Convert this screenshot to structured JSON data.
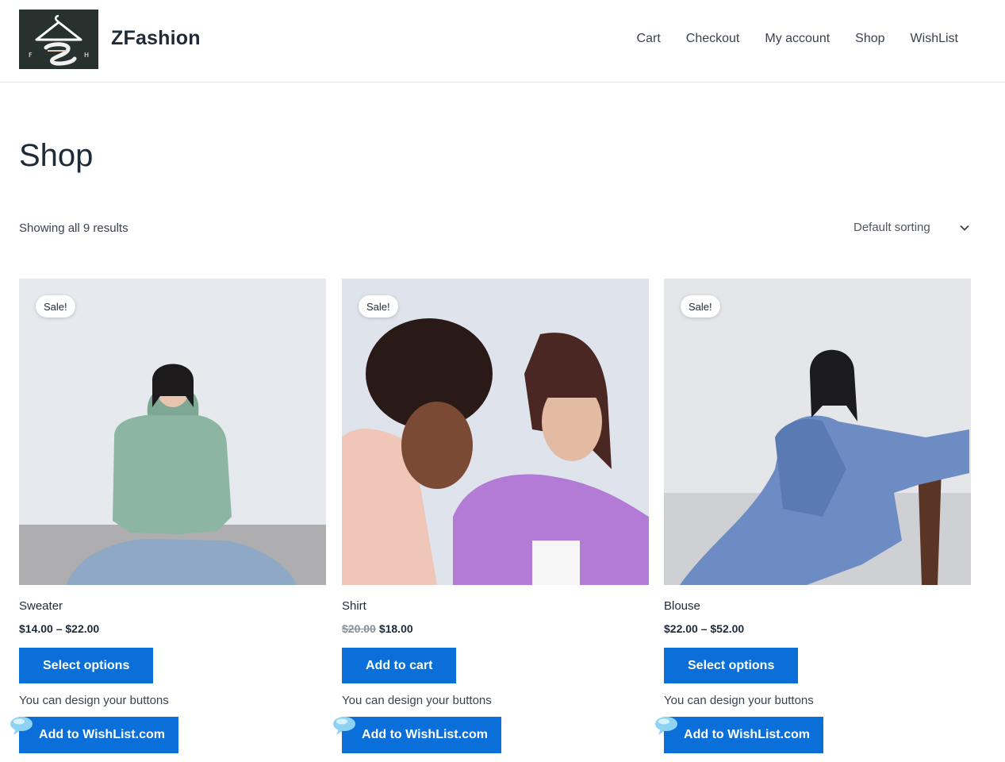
{
  "site": {
    "title": "ZFashion",
    "logo_icon": "hanger-logo-icon"
  },
  "nav": {
    "items": [
      "Cart",
      "Checkout",
      "My account",
      "Shop",
      "WishList"
    ]
  },
  "page": {
    "title": "Shop",
    "result_count": "Showing all 9 results",
    "ordering": "Default sorting"
  },
  "products": [
    {
      "name": "Sweater",
      "price": "$14.00 – $22.00",
      "old_price": "",
      "badge": "Sale!",
      "button": "Select options",
      "note": "You can design your buttons",
      "wishlist": "Add to WishList.com"
    },
    {
      "name": "Shirt",
      "price": "$18.00",
      "old_price": "$20.00",
      "badge": "Sale!",
      "button": "Add to cart",
      "note": "You can design your buttons",
      "wishlist": "Add to WishList.com"
    },
    {
      "name": "Blouse",
      "price": "$22.00 – $52.00",
      "old_price": "",
      "badge": "Sale!",
      "button": "Select options",
      "note": "You can design your buttons",
      "wishlist": "Add to WishList.com"
    }
  ],
  "colors": {
    "accent": "#0a6fd8",
    "text": "#1f2a37",
    "border": "#e3e6ea"
  }
}
